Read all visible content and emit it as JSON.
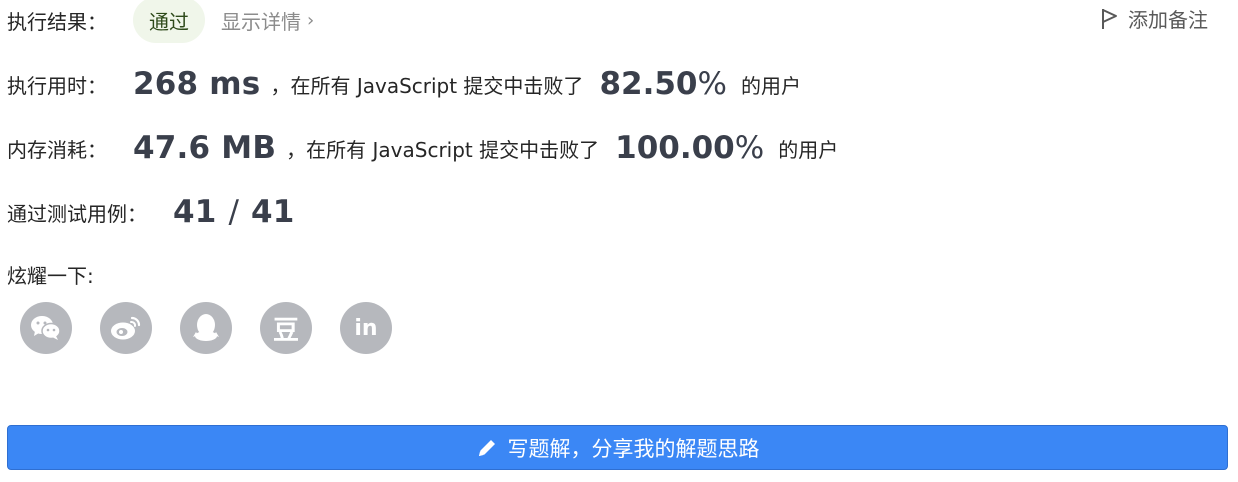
{
  "result": {
    "label": "执行结果：",
    "status": "通过",
    "details_link": "显示详情",
    "details_chevron": "›",
    "add_note": "添加备注"
  },
  "runtime": {
    "label": "执行用时：",
    "value": "268 ms",
    "text_before": "，在所有 JavaScript 提交中击败了",
    "percent_number": "82.50",
    "percent_sign": "%",
    "text_after": "的用户"
  },
  "memory": {
    "label": "内存消耗：",
    "value": "47.6 MB",
    "text_before": "，在所有 JavaScript 提交中击败了",
    "percent_number": "100.00",
    "percent_sign": "%",
    "text_after": "的用户"
  },
  "testcases": {
    "label": "通过测试用例：",
    "passed": "41",
    "separator": "/",
    "total": "41"
  },
  "share": {
    "label": "炫耀一下:",
    "items": [
      {
        "icon": "wechat-icon"
      },
      {
        "icon": "weibo-icon"
      },
      {
        "icon": "qq-icon"
      },
      {
        "icon": "douban-icon",
        "glyph": "豆"
      },
      {
        "icon": "linkedin-icon",
        "glyph": "in"
      }
    ]
  },
  "cta": {
    "label": "写题解，分享我的解题思路"
  },
  "colors": {
    "accent": "#3b87f5",
    "social_bg": "#b6b8bd",
    "success_bg": "#f0f6ea"
  }
}
